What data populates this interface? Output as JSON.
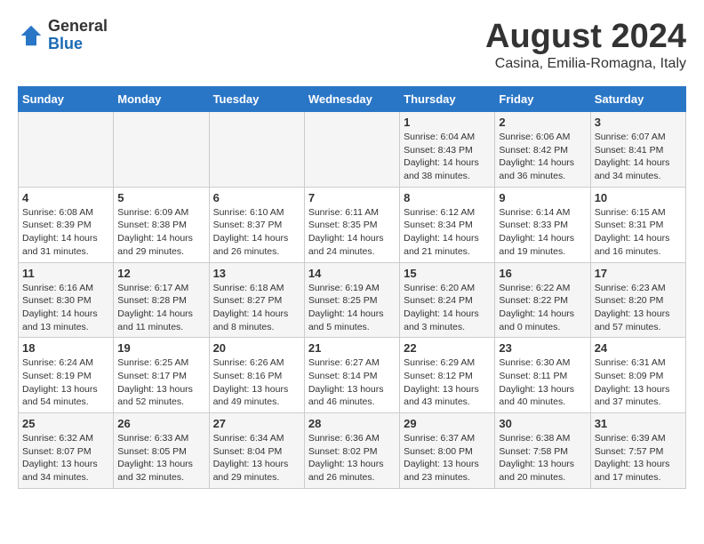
{
  "header": {
    "logo_general": "General",
    "logo_blue": "Blue",
    "main_title": "August 2024",
    "subtitle": "Casina, Emilia-Romagna, Italy"
  },
  "days_of_week": [
    "Sunday",
    "Monday",
    "Tuesday",
    "Wednesday",
    "Thursday",
    "Friday",
    "Saturday"
  ],
  "weeks": [
    [
      {
        "day": "",
        "info": ""
      },
      {
        "day": "",
        "info": ""
      },
      {
        "day": "",
        "info": ""
      },
      {
        "day": "",
        "info": ""
      },
      {
        "day": "1",
        "info": "Sunrise: 6:04 AM\nSunset: 8:43 PM\nDaylight: 14 hours\nand 38 minutes."
      },
      {
        "day": "2",
        "info": "Sunrise: 6:06 AM\nSunset: 8:42 PM\nDaylight: 14 hours\nand 36 minutes."
      },
      {
        "day": "3",
        "info": "Sunrise: 6:07 AM\nSunset: 8:41 PM\nDaylight: 14 hours\nand 34 minutes."
      }
    ],
    [
      {
        "day": "4",
        "info": "Sunrise: 6:08 AM\nSunset: 8:39 PM\nDaylight: 14 hours\nand 31 minutes."
      },
      {
        "day": "5",
        "info": "Sunrise: 6:09 AM\nSunset: 8:38 PM\nDaylight: 14 hours\nand 29 minutes."
      },
      {
        "day": "6",
        "info": "Sunrise: 6:10 AM\nSunset: 8:37 PM\nDaylight: 14 hours\nand 26 minutes."
      },
      {
        "day": "7",
        "info": "Sunrise: 6:11 AM\nSunset: 8:35 PM\nDaylight: 14 hours\nand 24 minutes."
      },
      {
        "day": "8",
        "info": "Sunrise: 6:12 AM\nSunset: 8:34 PM\nDaylight: 14 hours\nand 21 minutes."
      },
      {
        "day": "9",
        "info": "Sunrise: 6:14 AM\nSunset: 8:33 PM\nDaylight: 14 hours\nand 19 minutes."
      },
      {
        "day": "10",
        "info": "Sunrise: 6:15 AM\nSunset: 8:31 PM\nDaylight: 14 hours\nand 16 minutes."
      }
    ],
    [
      {
        "day": "11",
        "info": "Sunrise: 6:16 AM\nSunset: 8:30 PM\nDaylight: 14 hours\nand 13 minutes."
      },
      {
        "day": "12",
        "info": "Sunrise: 6:17 AM\nSunset: 8:28 PM\nDaylight: 14 hours\nand 11 minutes."
      },
      {
        "day": "13",
        "info": "Sunrise: 6:18 AM\nSunset: 8:27 PM\nDaylight: 14 hours\nand 8 minutes."
      },
      {
        "day": "14",
        "info": "Sunrise: 6:19 AM\nSunset: 8:25 PM\nDaylight: 14 hours\nand 5 minutes."
      },
      {
        "day": "15",
        "info": "Sunrise: 6:20 AM\nSunset: 8:24 PM\nDaylight: 14 hours\nand 3 minutes."
      },
      {
        "day": "16",
        "info": "Sunrise: 6:22 AM\nSunset: 8:22 PM\nDaylight: 14 hours\nand 0 minutes."
      },
      {
        "day": "17",
        "info": "Sunrise: 6:23 AM\nSunset: 8:20 PM\nDaylight: 13 hours\nand 57 minutes."
      }
    ],
    [
      {
        "day": "18",
        "info": "Sunrise: 6:24 AM\nSunset: 8:19 PM\nDaylight: 13 hours\nand 54 minutes."
      },
      {
        "day": "19",
        "info": "Sunrise: 6:25 AM\nSunset: 8:17 PM\nDaylight: 13 hours\nand 52 minutes."
      },
      {
        "day": "20",
        "info": "Sunrise: 6:26 AM\nSunset: 8:16 PM\nDaylight: 13 hours\nand 49 minutes."
      },
      {
        "day": "21",
        "info": "Sunrise: 6:27 AM\nSunset: 8:14 PM\nDaylight: 13 hours\nand 46 minutes."
      },
      {
        "day": "22",
        "info": "Sunrise: 6:29 AM\nSunset: 8:12 PM\nDaylight: 13 hours\nand 43 minutes."
      },
      {
        "day": "23",
        "info": "Sunrise: 6:30 AM\nSunset: 8:11 PM\nDaylight: 13 hours\nand 40 minutes."
      },
      {
        "day": "24",
        "info": "Sunrise: 6:31 AM\nSunset: 8:09 PM\nDaylight: 13 hours\nand 37 minutes."
      }
    ],
    [
      {
        "day": "25",
        "info": "Sunrise: 6:32 AM\nSunset: 8:07 PM\nDaylight: 13 hours\nand 34 minutes."
      },
      {
        "day": "26",
        "info": "Sunrise: 6:33 AM\nSunset: 8:05 PM\nDaylight: 13 hours\nand 32 minutes."
      },
      {
        "day": "27",
        "info": "Sunrise: 6:34 AM\nSunset: 8:04 PM\nDaylight: 13 hours\nand 29 minutes."
      },
      {
        "day": "28",
        "info": "Sunrise: 6:36 AM\nSunset: 8:02 PM\nDaylight: 13 hours\nand 26 minutes."
      },
      {
        "day": "29",
        "info": "Sunrise: 6:37 AM\nSunset: 8:00 PM\nDaylight: 13 hours\nand 23 minutes."
      },
      {
        "day": "30",
        "info": "Sunrise: 6:38 AM\nSunset: 7:58 PM\nDaylight: 13 hours\nand 20 minutes."
      },
      {
        "day": "31",
        "info": "Sunrise: 6:39 AM\nSunset: 7:57 PM\nDaylight: 13 hours\nand 17 minutes."
      }
    ]
  ]
}
